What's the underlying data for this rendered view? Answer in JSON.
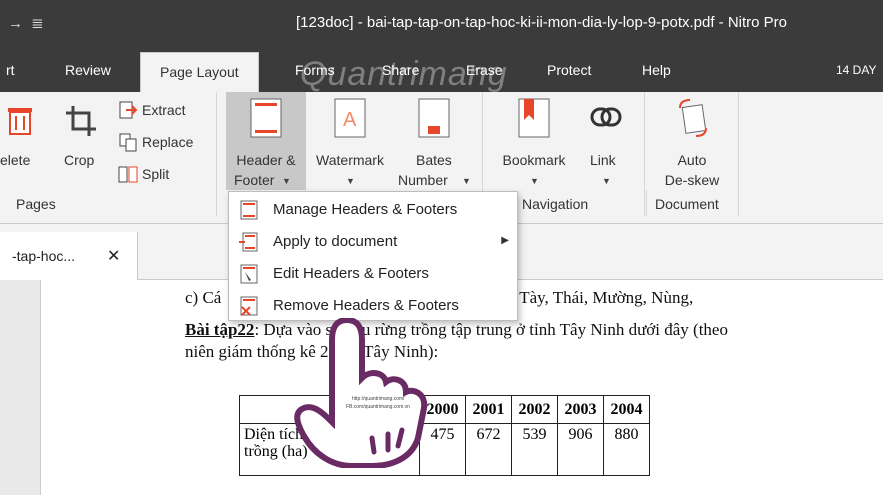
{
  "titlebar": {
    "quick_access": "→ ≣",
    "title": "[123doc] - bai-tap-tap-on-tap-hoc-ki-ii-mon-dia-ly-lop-9-potx.pdf - Nitro Pro"
  },
  "tabs": {
    "t0": "rt",
    "t1": "Review",
    "t2": "Page Layout",
    "t3": "Forms",
    "t4": "Share",
    "t5": "Erase",
    "t6": "Protect",
    "t7": "Help",
    "date": "14 DAY"
  },
  "ribbon": {
    "delete": "elete",
    "crop": "Crop",
    "extract": "Extract",
    "replace": "Replace",
    "split": "Split",
    "pages_group": "Pages",
    "header_footer_1": "Header &",
    "header_footer_2": "Footer",
    "watermark": "Watermark",
    "bates_1": "Bates",
    "bates_2": "Number",
    "bookmark": "Bookmark",
    "link": "Link",
    "navigation_group": "Navigation",
    "auto_deskew_1": "Auto",
    "auto_deskew_2": "De-skew",
    "document_group": "Document"
  },
  "doc_tab": {
    "name": "-tap-hoc...",
    "close": "✕"
  },
  "menu": {
    "item0": "Manage Headers & Footers",
    "item1": "Apply to document",
    "item2": "Edit Headers & Footers",
    "item3": "Remove Headers & Footers"
  },
  "document": {
    "line1_start": "c) Cá",
    "line1_end": ", Tày, Thái, Mường, Nùng,",
    "line2_bold": "Bài tập22",
    "line2_rest": ": Dựa vào     số liệu rừng trồng tập trung ở tỉnh Tây Ninh dưới đây (theo",
    "line3": "niên giám thống kê 2      tỉnh Tây Ninh):",
    "table": {
      "years": [
        "2000",
        "2001",
        "2002",
        "2003",
        "2004"
      ],
      "row_label_1": "Diện tích rừn",
      "row_label_2": "trồng (ha)",
      "values": [
        "475",
        "672",
        "539",
        "906",
        "880"
      ]
    }
  },
  "watermark": {
    "text": "Quantrimang",
    "hand_text_1": "http://quantrimang.com/",
    "hand_text_2": "FB.com/quantrimang.com.vn"
  }
}
